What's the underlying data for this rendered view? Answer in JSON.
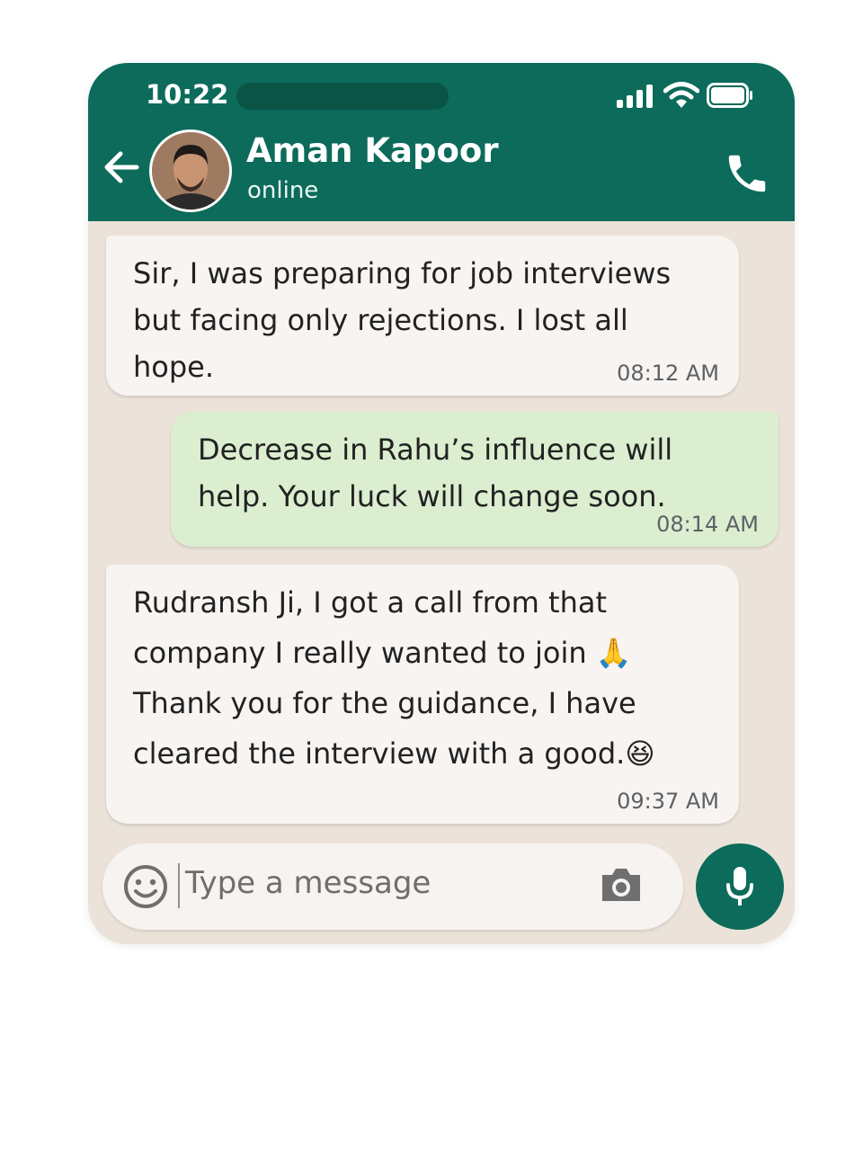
{
  "status_bar": {
    "time": "10:22"
  },
  "header": {
    "contact_name": "Aman Kapoor",
    "contact_status": "online"
  },
  "messages": [
    {
      "direction": "incoming",
      "text": "Sir, I was preparing for job interviews\nbut facing only rejections. I lost all\nhope.",
      "time": "08:12 AM"
    },
    {
      "direction": "outgoing",
      "text": "Decrease in Rahu’s influence will\nhelp. Your luck will change soon.",
      "time": "08:14 AM"
    },
    {
      "direction": "incoming",
      "text": "Rudransh Ji, I got a call from that\ncompany I really wanted to join 🙏\nThank you for the guidance, I have\ncleared the interview with a good.😆",
      "time": "09:37 AM"
    }
  ],
  "composer": {
    "placeholder": "Type a message"
  },
  "icons": {
    "back": "arrow-left-icon",
    "call": "phone-icon",
    "emoji": "smiley-icon",
    "camera": "camera-icon",
    "mic": "microphone-icon",
    "signal": "signal-icon",
    "wifi": "wifi-icon",
    "battery": "battery-icon"
  },
  "colors": {
    "header": "#0c6b5a",
    "incoming_bubble": "#f7f4f2",
    "outgoing_bubble": "#dbeed0",
    "wallpaper": "#ebe3d9"
  }
}
